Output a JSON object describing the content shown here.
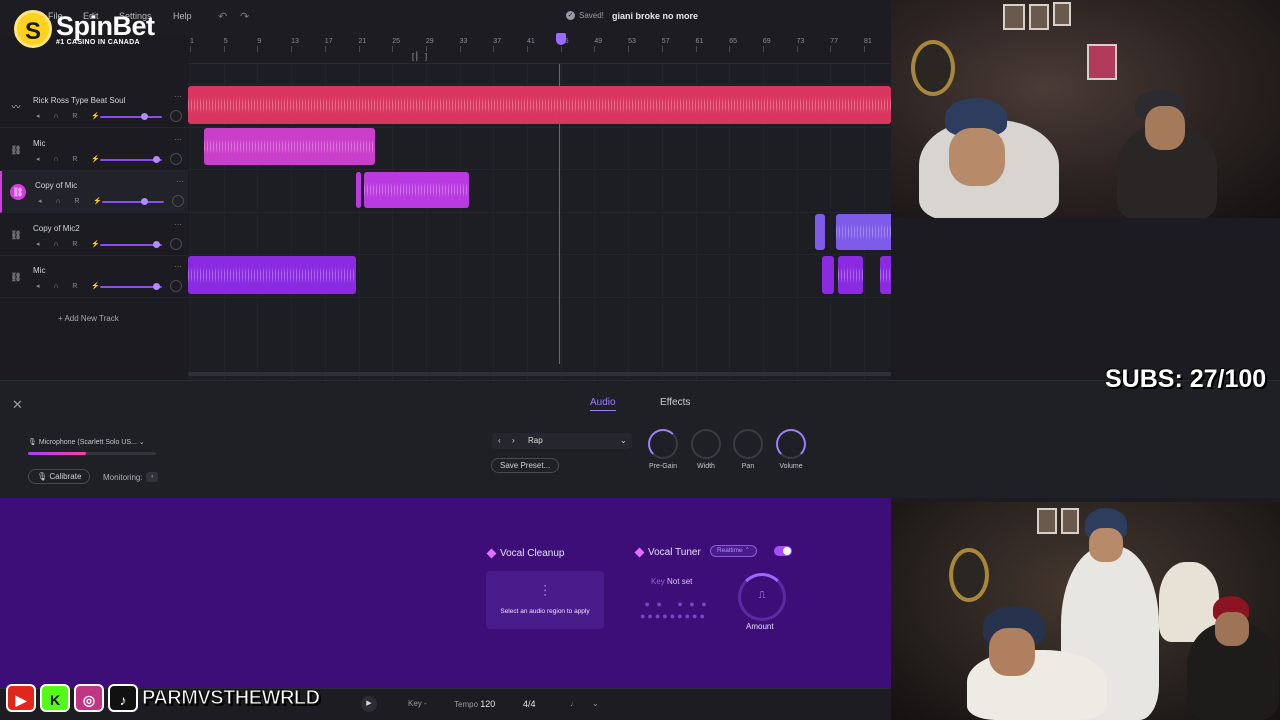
{
  "brand": {
    "name": "SpinBet",
    "tagline": "#1 CASINO IN CANADA",
    "coin_letter": "S"
  },
  "menu": [
    "File",
    "Edit",
    "Settings",
    "Help"
  ],
  "status": {
    "saved": "Saved!",
    "project": "giani broke no more"
  },
  "ruler": [
    "1",
    "5",
    "9",
    "13",
    "17",
    "21",
    "25",
    "29",
    "33",
    "37",
    "41",
    "45",
    "49",
    "53",
    "57",
    "61",
    "65",
    "69",
    "73",
    "77",
    "81"
  ],
  "tracks": [
    {
      "name": "Rick Ross Type Beat Soul",
      "volume": 0.75
    },
    {
      "name": "Mic",
      "volume": 0.97
    },
    {
      "name": "Copy of Mic",
      "volume": 0.7
    },
    {
      "name": "Copy of Mic2",
      "volume": 0.97
    },
    {
      "name": "Mic",
      "volume": 0.97
    }
  ],
  "add_track": "+ Add New Track",
  "panel": {
    "tabs": [
      "Audio",
      "Effects"
    ],
    "mic": "Microphone (Scarlett Solo US...",
    "input_level": 0.45,
    "calibrate": "Calibrate",
    "monitoring": "Monitoring:",
    "preset": "Rap",
    "save_preset": "Save Preset...",
    "knobs": [
      "Pre-Gain",
      "Width",
      "Pan",
      "Volume"
    ]
  },
  "fx": {
    "cleanup_title": "Vocal Cleanup",
    "cleanup_msg": "Select an audio region to apply",
    "tuner_title": "Vocal Tuner",
    "tuner_mode": "Realtime",
    "key_label": "Key",
    "key_value": "Not set",
    "amount": "Amount"
  },
  "transport": {
    "key": "Key",
    "tempo_label": "Tempo",
    "tempo": "120",
    "time_sig": "4/4"
  },
  "social_handle": "PARMVSTHEWRLD",
  "subs": "SUBS: 27/100",
  "colors": {
    "accent": "#9a6cff",
    "beat": "#d8365e",
    "mic_pink": "#c93fc9",
    "mic_purple": "#8a2be2"
  }
}
